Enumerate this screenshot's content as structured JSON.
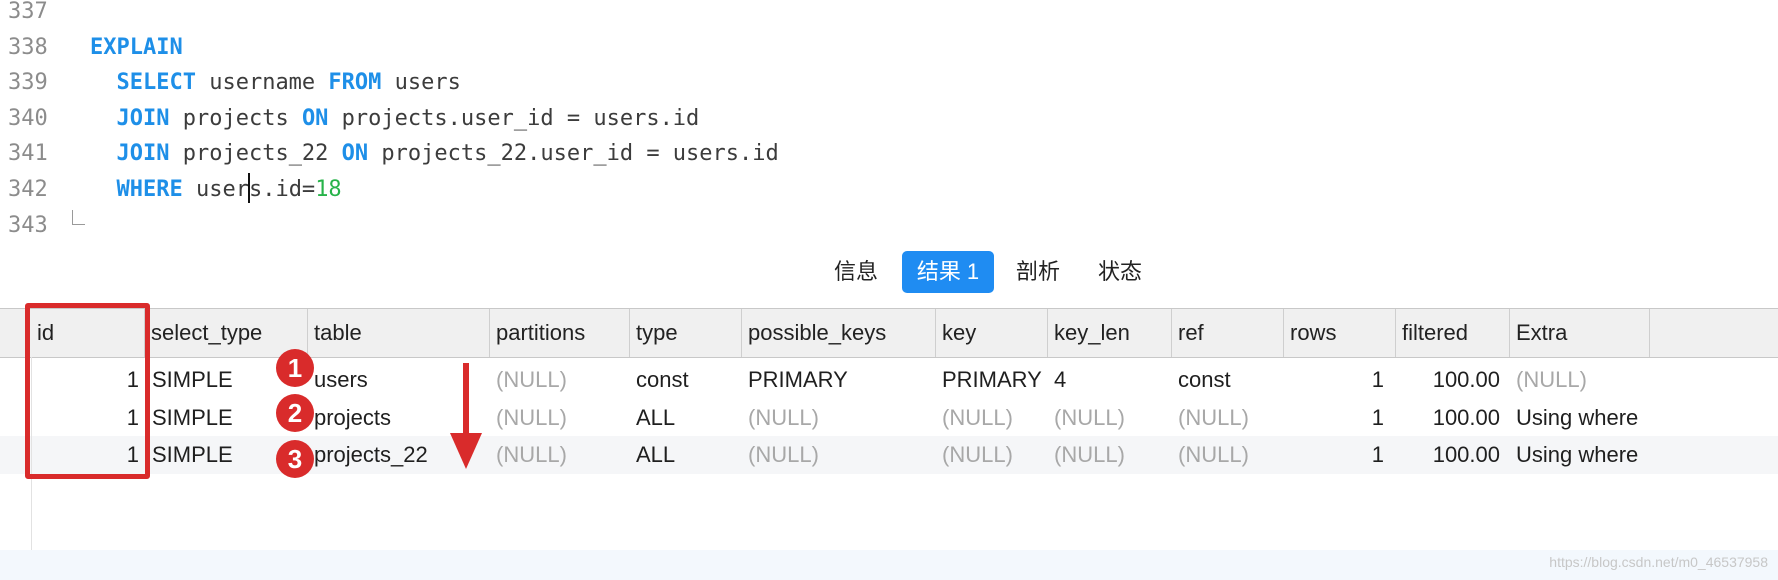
{
  "editor": {
    "lines": [
      {
        "num": "337",
        "tokens": []
      },
      {
        "num": "338",
        "tokens": [
          {
            "t": "EXPLAIN",
            "k": "kw"
          }
        ]
      },
      {
        "num": "339",
        "tokens": [
          {
            "t": "  SELECT",
            "k": "kw"
          },
          {
            "t": " username ",
            "k": "txt"
          },
          {
            "t": "FROM",
            "k": "kw"
          },
          {
            "t": " users",
            "k": "txt"
          }
        ]
      },
      {
        "num": "340",
        "tokens": [
          {
            "t": "  JOIN",
            "k": "kw"
          },
          {
            "t": " projects ",
            "k": "txt"
          },
          {
            "t": "ON",
            "k": "kw"
          },
          {
            "t": " projects.user_id = users.id",
            "k": "txt"
          }
        ]
      },
      {
        "num": "341",
        "tokens": [
          {
            "t": "  JOIN",
            "k": "kw"
          },
          {
            "t": " projects_22 ",
            "k": "txt"
          },
          {
            "t": "ON",
            "k": "kw"
          },
          {
            "t": " projects_22.user_id = users.id",
            "k": "txt"
          }
        ]
      },
      {
        "num": "342",
        "tokens": [
          {
            "t": "  WHERE",
            "k": "kw"
          },
          {
            "t": " user",
            "k": "txt"
          },
          {
            "t": "",
            "k": "caret"
          },
          {
            "t": "s.id=",
            "k": "txt"
          },
          {
            "t": "18",
            "k": "num"
          }
        ]
      },
      {
        "num": "343",
        "tokens": []
      }
    ]
  },
  "tabs": [
    {
      "label": "信息",
      "active": false
    },
    {
      "label": "结果 1",
      "active": true
    },
    {
      "label": "剖析",
      "active": false
    },
    {
      "label": "状态",
      "active": false
    }
  ],
  "grid": {
    "columns": [
      "id",
      "select_type",
      "table",
      "partitions",
      "type",
      "possible_keys",
      "key",
      "key_len",
      "ref",
      "rows",
      "filtered",
      "Extra"
    ],
    "rows": [
      [
        "1",
        "SIMPLE",
        "users",
        "(NULL)",
        "const",
        "PRIMARY",
        "PRIMARY",
        "4",
        "const",
        "1",
        "100.00",
        "(NULL)"
      ],
      [
        "1",
        "SIMPLE",
        "projects",
        "(NULL)",
        "ALL",
        "(NULL)",
        "(NULL)",
        "(NULL)",
        "(NULL)",
        "1",
        "100.00",
        "Using where"
      ],
      [
        "1",
        "SIMPLE",
        "projects_22",
        "(NULL)",
        "ALL",
        "(NULL)",
        "(NULL)",
        "(NULL)",
        "(NULL)",
        "1",
        "100.00",
        "Using where"
      ]
    ]
  },
  "annotations": {
    "badges": [
      "1",
      "2",
      "3"
    ],
    "accent_color": "#d92b2b"
  },
  "watermark": "https://blog.csdn.net/m0_46537958"
}
